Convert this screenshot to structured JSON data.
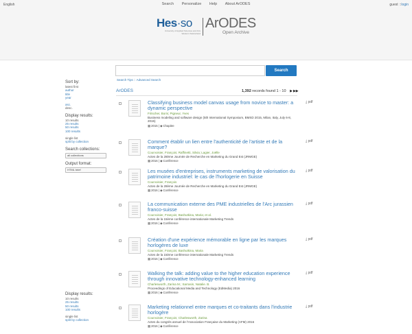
{
  "header": {
    "language": "English",
    "nav": [
      "Search",
      "Personalize",
      "Help",
      "About ArODES"
    ],
    "user": "guest",
    "login_icon_label": "login",
    "logo": {
      "hes": "Hes",
      "dot": "·",
      "so": "so",
      "hes_subtitle": "University of Applied Sciences and Arts Western Switzerland",
      "arodes": "ArODES",
      "open_archive": "Open Archive"
    }
  },
  "search": {
    "query": "",
    "button": "Search",
    "tips": "Search Tips",
    "sep": "::",
    "advanced": "Advanced Search"
  },
  "sidebar": {
    "sort_heading": "Sort by:",
    "sort_options": [
      "latest first",
      "author",
      "title",
      "year"
    ],
    "order_options": [
      "asc.",
      "desc."
    ],
    "display_heading": "Display results:",
    "display_options": [
      "10 results",
      "25 results",
      "50 results",
      "100 results"
    ],
    "list_options": [
      "single list",
      "split by collection"
    ],
    "collections_heading": "Search collections:",
    "collections_value": "all collections",
    "format_heading": "Output format:",
    "format_value": "HTML brief"
  },
  "results_header": {
    "breadcrumb": "ArODES",
    "total": "1,392",
    "records_label": "records found",
    "range": "1 - 10",
    "next_icon": "double-chevron-right",
    "last_icon": "last-page"
  },
  "results": [
    {
      "title": "Classifying business model canvas usage from novice to master: a dynamic perspective",
      "authors": "Fritscher, Boris; Pigneur, Yves",
      "venue": "Business modeling and software design (5th International Symposium, BMSD 2015, Milan, Italy, July 6-8, 2015)",
      "year": "2015",
      "type": "Chapitre",
      "pdf": "pdf"
    },
    {
      "title": "Comment établir un lien entre l'authenticité de l'artiste et de la marque?",
      "authors": "Courvoisier, François; Raffinetti, Silvia; Lagier, Joëlle",
      "venue": "Actes de la 28ème Journée de Recherche en Marketing du Grand Est (JRMGE)",
      "year": "2016",
      "type": "Conférence",
      "pdf": "pdf"
    },
    {
      "title": "Les musées d'entreprises, instruments marketing de valorisation du patrimoine industriel: le cas de l'horlogerie en Suisse",
      "authors": "Courvoisier, François",
      "venue": "Actes de la 28ème Journée de Recherche en Marketing du Grand Est (JRMGE)",
      "year": "2016",
      "type": "Conférence",
      "pdf": "pdf"
    },
    {
      "title": "La communication externe des PME industrielles de l'Arc jurassien franco-suisse",
      "authors": "Courvoisier, François; Bashutkina, Maria; et al.",
      "venue": "Actes de la 15ème conférence internationale Marketing Trends",
      "year": "2016",
      "type": "Conférence",
      "pdf": "pdf"
    },
    {
      "title": "Création d'une expérience mémorable en ligne par les marques horlogères de luxe",
      "authors": "Courvoisier, François; Bashutkina, Maria",
      "venue": "Actes de la 15ème conférence internationale Marketing Trends",
      "year": "2016",
      "type": "Conférence",
      "pdf": "pdf"
    },
    {
      "title": "Walking the talk: adding value to the higher education experience through innovative technology-enhanced learning",
      "authors": "Charlesworth, Zarina M.; Sarrasin, Natalie. B.",
      "venue": "Proceedings of Educational Media and Technology (EdMedia) 2016",
      "year": "2016",
      "type": "Conférence",
      "pdf": "pdf"
    },
    {
      "title": "Marketing relationnel entre marques et co-traitants dans l'industrie horlogère",
      "authors": "Courvoisier, François; Charlesworth, Zarina",
      "venue": "Actes du congrès annuel de l'Association Française du Marketing (AFM) 2016",
      "year": "2016",
      "type": "Conférence",
      "pdf": "pdf"
    }
  ],
  "sidebar_bottom": {
    "display_heading": "Display results:",
    "display_options": [
      "10 results",
      "25 results",
      "50 results",
      "100 results"
    ],
    "list_options": [
      "single list",
      "split by collection"
    ]
  }
}
